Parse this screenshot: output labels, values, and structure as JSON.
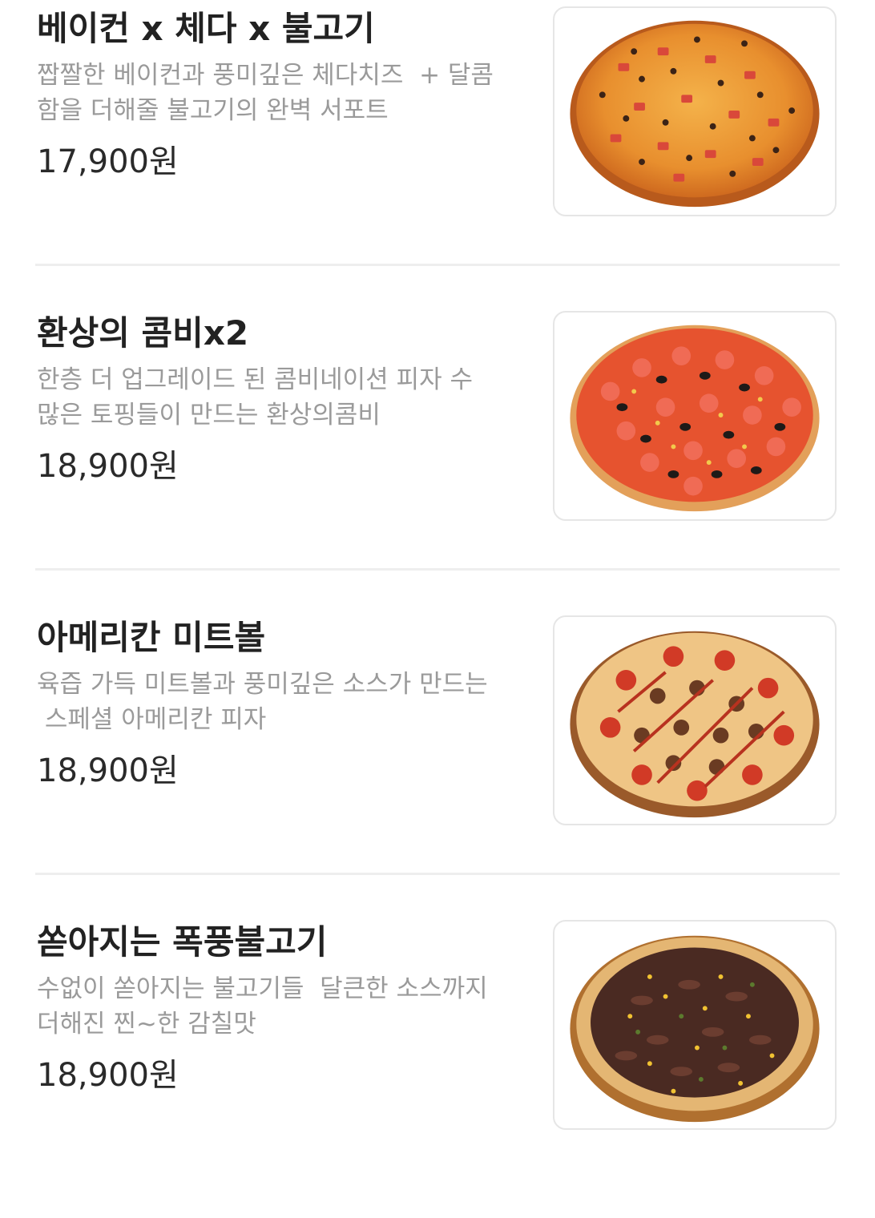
{
  "menu": {
    "items": [
      {
        "name": "베이컨 x 체다 x 불고기",
        "description": "짭짤한 베이컨과 풍미깊은 체다치즈  + 달콤\n함을 더해줄 불고기의 완벽 서포트",
        "price": "17,900원",
        "image_icon": "bacon-cheddar-bulgogi-pizza-image"
      },
      {
        "name": "환상의 콤비x2",
        "description": "한층 더 업그레이드 된 콤비네이션 피자 수\n많은 토핑들이 만드는 환상의콤비",
        "price": "18,900원",
        "image_icon": "combination-pizza-image"
      },
      {
        "name": "아메리칸 미트볼",
        "description": "육즙 가득 미트볼과 풍미깊은 소스가 만드는\n 스페셜 아메리칸 피자",
        "price": "18,900원",
        "image_icon": "american-meatball-pizza-image"
      },
      {
        "name": "쏟아지는 폭풍불고기",
        "description": "수없이 쏟아지는 불고기들  달큰한 소스까지\n더해진 찐~한 감칠맛",
        "price": "18,900원",
        "image_icon": "storm-bulgogi-pizza-image"
      }
    ]
  },
  "colors": {
    "title": "#222222",
    "description": "#9a9a9a",
    "price": "#2a2a2a",
    "divider": "#eeeeee",
    "card_border": "#e6e6e6"
  }
}
